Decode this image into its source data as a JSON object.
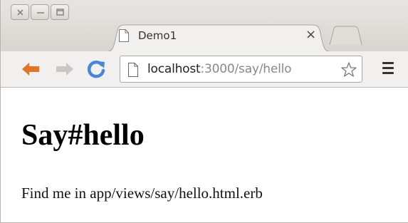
{
  "window": {
    "controls": [
      "close-icon",
      "minimize-icon",
      "maximize-icon"
    ]
  },
  "tabs": [
    {
      "title": "Demo1",
      "close_label": "×",
      "icon": "page-icon",
      "active": true
    }
  ],
  "toolbar": {
    "back_icon": "back-arrow-icon",
    "forward_icon": "forward-arrow-icon",
    "reload_icon": "reload-icon",
    "url_host": "localhost",
    "url_rest": ":3000/say/hello",
    "bookmark_icon": "star-icon",
    "menu_icon": "hamburger-menu-icon"
  },
  "page": {
    "heading": "Say#hello",
    "paragraph": "Find me in app/views/say/hello.html.erb"
  },
  "colors": {
    "back_arrow": "#e0742a",
    "reload": "#4a86d4",
    "forward_arrow_disabled": "#c9c7c3"
  }
}
